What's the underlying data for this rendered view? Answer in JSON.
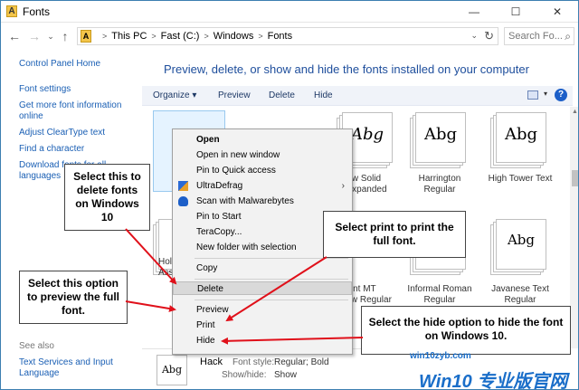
{
  "window": {
    "title": "Fonts",
    "app_icon": "A",
    "min": "—",
    "max": "☐",
    "close": "✕"
  },
  "address": {
    "path": [
      "This PC",
      "Fast (C:)",
      "Windows",
      "Fonts"
    ],
    "search_placeholder": "Search Fo..."
  },
  "sidebar": {
    "home": "Control Panel Home",
    "links": [
      "Font settings",
      "Get more font information online",
      "Adjust ClearType text",
      "Find a character",
      "Download fonts for all languages"
    ],
    "see_also_label": "See also",
    "see_also": [
      "Text Services and Input Language"
    ]
  },
  "main": {
    "heading": "Preview, delete, or show and hide the fonts installed on your computer",
    "toolbar": {
      "organize": "Organize ▾",
      "preview": "Preview",
      "delete": "Delete",
      "hide": "Hide",
      "help": "?"
    }
  },
  "fonts": [
    {
      "name": "w Solid\nExpanded",
      "sample": "Abg"
    },
    {
      "name": "Harrington\nRegular",
      "sample": "Abg"
    },
    {
      "name": "High Tower Text",
      "sample": "Abg"
    },
    {
      "name": "Hol\nAss",
      "sample": ""
    },
    {
      "name": "print MT\nrow Regular",
      "sample": ""
    },
    {
      "name": "Informal Roman\nRegular",
      "sample": ""
    },
    {
      "name": "Javanese Text\nRegular",
      "sample": "Abg"
    }
  ],
  "context_menu": {
    "open": "Open",
    "open_new_window": "Open in new window",
    "pin_quick_access": "Pin to Quick access",
    "ultradefrag": "UltraDefrag",
    "malwarebytes": "Scan with Malwarebytes",
    "pin_start": "Pin to Start",
    "teracopy": "TeraCopy...",
    "new_folder": "New folder with selection",
    "copy": "Copy",
    "delete": "Delete",
    "preview": "Preview",
    "print": "Print",
    "hide": "Hide"
  },
  "details": {
    "thumb": "Abg",
    "name": "Hack",
    "style_label": "Font style:",
    "style_value": "Regular; Bold",
    "showhide_label": "Show/hide:",
    "showhide_value": "Show"
  },
  "callouts": {
    "delete": "Select this to delete fonts on Windows 10",
    "preview": "Select this option to preview the full font.",
    "print": "Select print to print the full font.",
    "hide": "Select the hide option to hide the font on Windows 10."
  },
  "watermark": {
    "site": "win10zyb.com",
    "brand": "Win10 专业版官网"
  }
}
